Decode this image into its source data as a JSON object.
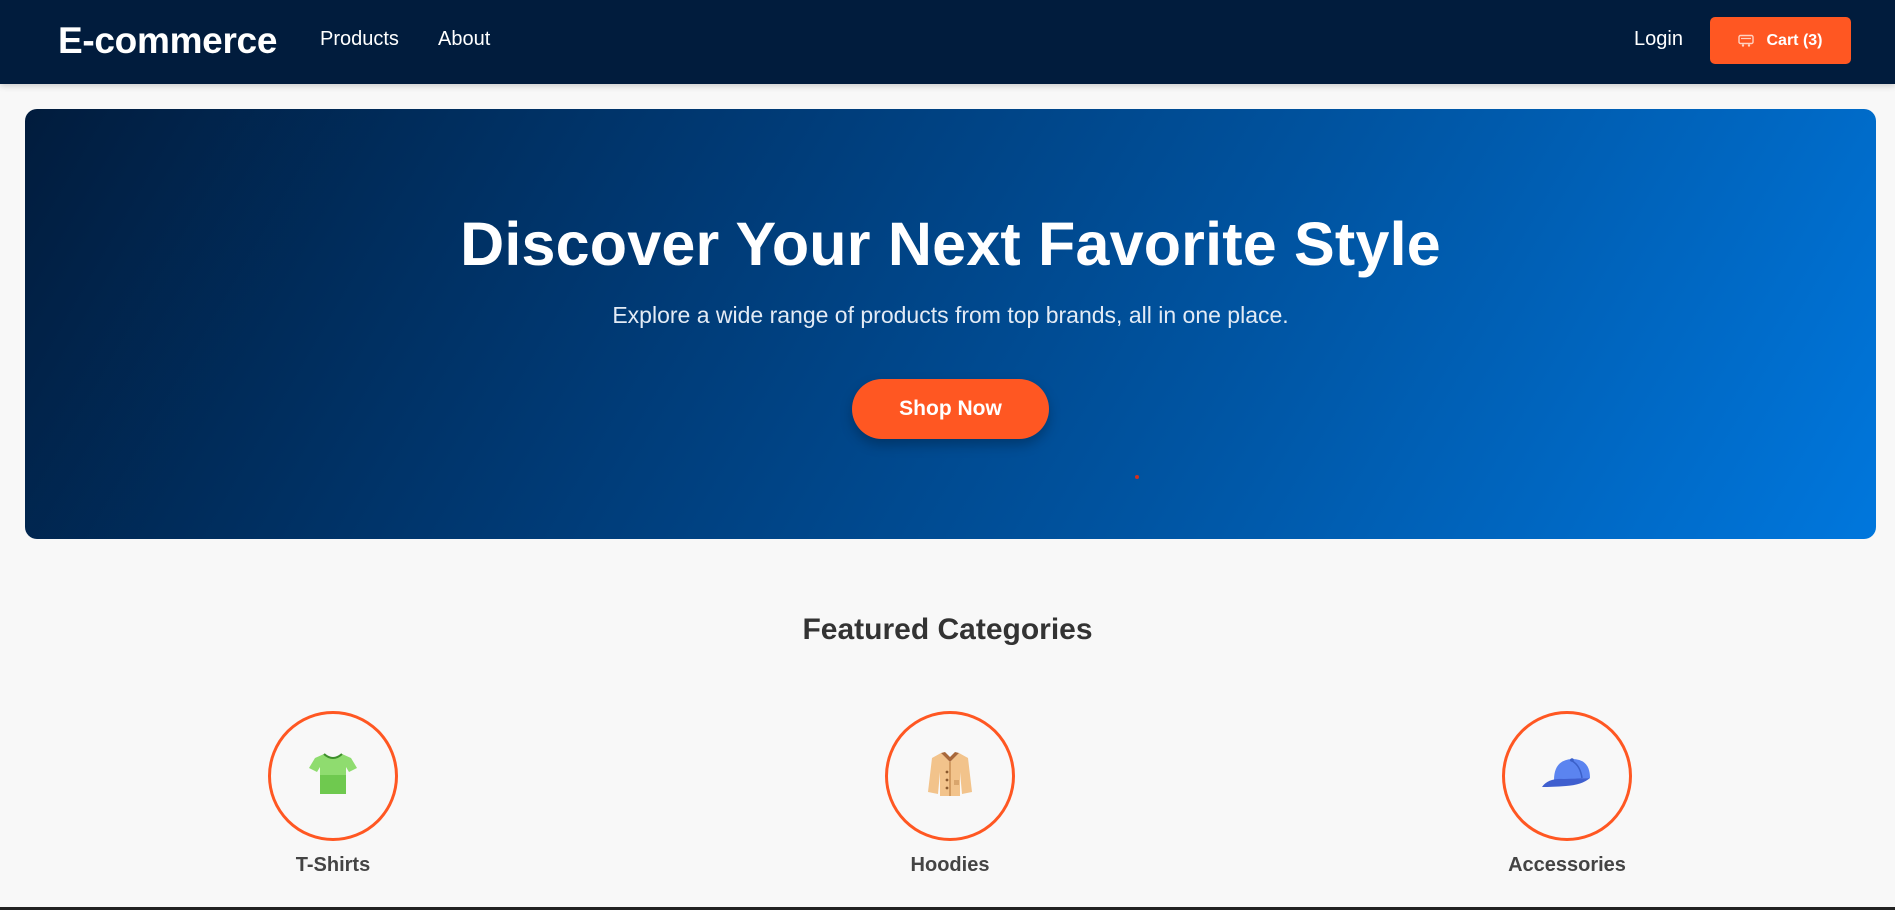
{
  "header": {
    "brand": "E-commerce",
    "nav": [
      {
        "label": "Products"
      },
      {
        "label": "About"
      }
    ],
    "login_label": "Login",
    "cart_label": "Cart (3)",
    "cart_icon": "cart-icon"
  },
  "hero": {
    "title": "Discover Your Next Favorite Style",
    "subtitle": "Explore a wide range of products from top brands, all in one place.",
    "cta_label": "Shop Now"
  },
  "categories": {
    "title": "Featured Categories",
    "items": [
      {
        "label": "T-Shirts",
        "icon": "tshirt-icon"
      },
      {
        "label": "Hoodies",
        "icon": "coat-icon"
      },
      {
        "label": "Accessories",
        "icon": "cap-icon"
      }
    ]
  },
  "colors": {
    "navbar": "#011c3d",
    "accent": "#ff5722",
    "hero_start": "#011c3d",
    "hero_end": "#0077dd",
    "page_background": "#f8f8f8"
  }
}
